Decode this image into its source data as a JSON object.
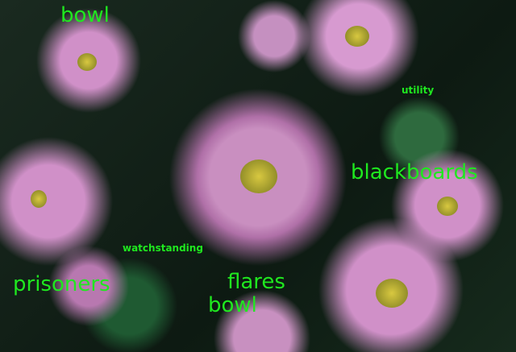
{
  "labels": {
    "bowl_top": "bowl",
    "utility": "utility",
    "blackboards": "blackboards",
    "watchstanding": "watchstanding",
    "prisoners": "prisoners",
    "flares": "flares",
    "bowl_bottom": "bowl"
  },
  "label_color": "#1fe81f"
}
